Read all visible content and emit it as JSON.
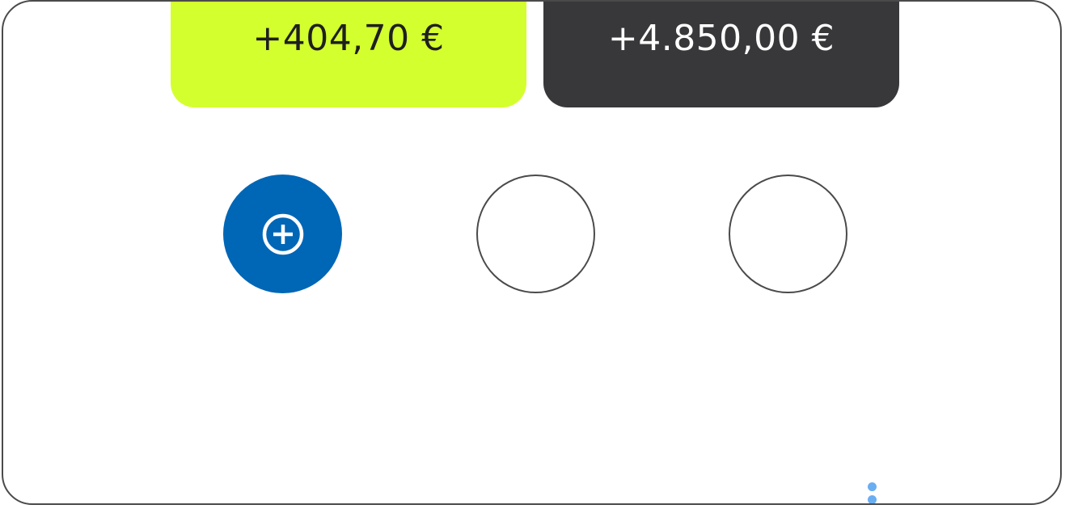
{
  "cards": [
    {
      "amount": "+404,70 €",
      "color": "#d4ff2e"
    },
    {
      "amount": "+4.850,00 €",
      "color": "#38383a"
    }
  ],
  "actions": {
    "add_icon": "plus-circle-icon",
    "accent_color": "#0066b6",
    "placeholder_count": 2
  },
  "indicator": {
    "icon": "vertical-dots-icon",
    "color": "#6aaef2"
  }
}
